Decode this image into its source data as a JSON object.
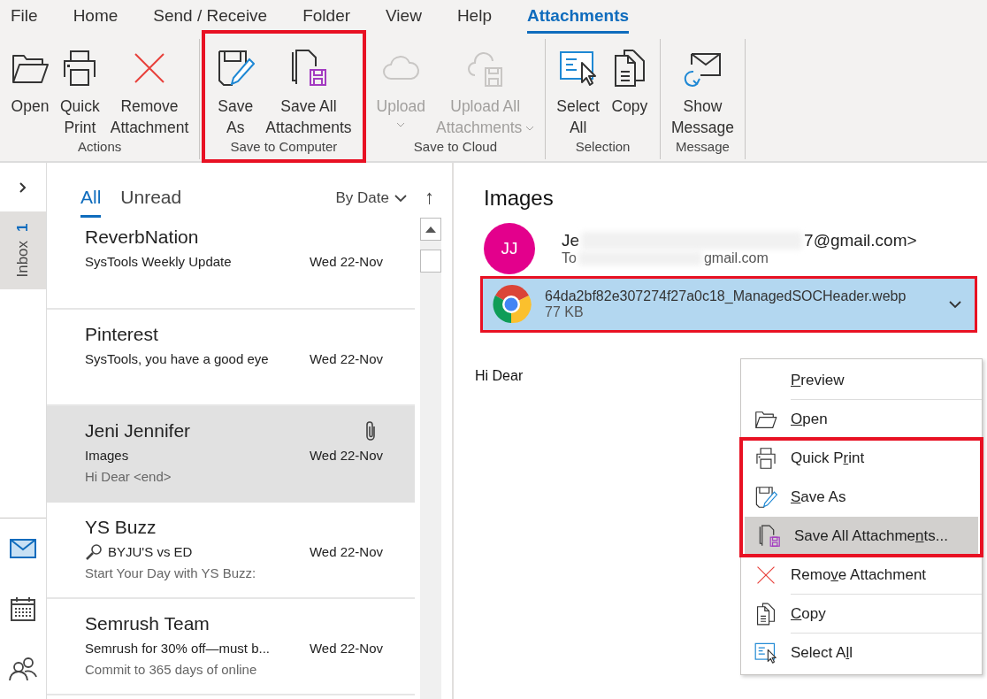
{
  "menu_tabs": [
    {
      "label": "File",
      "selected": false
    },
    {
      "label": "Home",
      "selected": false
    },
    {
      "label": "Send / Receive",
      "selected": false
    },
    {
      "label": "Folder",
      "selected": false
    },
    {
      "label": "View",
      "selected": false
    },
    {
      "label": "Help",
      "selected": false
    },
    {
      "label": "Attachments",
      "selected": true
    }
  ],
  "ribbon_groups": [
    {
      "label": "Actions",
      "highlighted": false,
      "buttons": [
        {
          "lines": [
            "Open"
          ],
          "disabled": false,
          "dropdown": false
        },
        {
          "lines": [
            "Quick",
            "Print"
          ],
          "disabled": false,
          "dropdown": false
        },
        {
          "lines": [
            "Remove",
            "Attachment"
          ],
          "disabled": false,
          "dropdown": false
        }
      ]
    },
    {
      "label": "Save to Computer",
      "highlighted": true,
      "buttons": [
        {
          "lines": [
            "Save",
            "As"
          ],
          "disabled": false,
          "dropdown": false
        },
        {
          "lines": [
            "Save All",
            "Attachments"
          ],
          "disabled": false,
          "dropdown": false
        }
      ]
    },
    {
      "label": "Save to Cloud",
      "highlighted": false,
      "buttons": [
        {
          "lines": [
            "Upload"
          ],
          "disabled": true,
          "dropdown": true
        },
        {
          "lines": [
            "Upload All",
            "Attachments"
          ],
          "disabled": true,
          "dropdown": true
        }
      ]
    },
    {
      "label": "Selection",
      "highlighted": false,
      "buttons": [
        {
          "lines": [
            "Select",
            "All"
          ],
          "disabled": false,
          "dropdown": false
        },
        {
          "lines": [
            "Copy"
          ],
          "disabled": false,
          "dropdown": false
        }
      ]
    },
    {
      "label": "Message",
      "highlighted": false,
      "buttons": [
        {
          "lines": [
            "Show",
            "Message"
          ],
          "disabled": false,
          "dropdown": false
        }
      ]
    }
  ],
  "nav_rail": {
    "folder": "Inbox",
    "count": "1",
    "apps": [
      {
        "selected": true
      },
      {
        "selected": false
      },
      {
        "selected": false
      }
    ]
  },
  "message_list": {
    "filters": [
      {
        "label": "All",
        "selected": true
      },
      {
        "label": "Unread",
        "selected": false
      }
    ],
    "sort": "By Date",
    "sort_direction": "↑",
    "messages": [
      {
        "sender": "ReverbNation",
        "subject": "SysTools Weekly Update",
        "date": "Wed 22-Nov",
        "selected": false,
        "attachment": false
      },
      {
        "sender": "Pinterest",
        "subject": "SysTools, you have a good eye",
        "date": "Wed 22-Nov",
        "selected": false,
        "attachment": false
      },
      {
        "sender": "Jeni Jennifer",
        "subject": "Images",
        "date": "Wed 22-Nov",
        "preview": "Hi Dear <end>",
        "selected": true,
        "attachment": true
      },
      {
        "sender": "YS Buzz",
        "subject": "BYJU'S vs ED",
        "date": "Wed 22-Nov",
        "preview": "Start Your Day with YS Buzz:",
        "selected": false,
        "attachment": false
      },
      {
        "sender": "Semrush Team",
        "subject": "Semrush for 30% off—must b...",
        "date": "Wed 22-Nov",
        "preview": "Commit to 365 days of online",
        "selected": false,
        "attachment": false
      }
    ]
  },
  "reading_pane": {
    "subject": "Images",
    "avatar_initials": "JJ",
    "from_start": "Je",
    "from_end": "7@gmail.com>",
    "to_label": "To",
    "to_end": "gmail.com",
    "attachment": {
      "name": "64da2bf82e307274f27a0c18_ManagedSOCHeader.webp",
      "size": "77 KB",
      "highlighted": true
    },
    "body": "Hi Dear"
  },
  "context_menu": {
    "sections": [
      {
        "highlighted": false,
        "items": [
          {
            "label_parts": [
              {
                "text": "P",
                "underline": true
              },
              {
                "text": "review",
                "underline": false
              }
            ],
            "selected": false
          },
          {
            "label_parts": [
              {
                "text": "O",
                "underline": true
              },
              {
                "text": "pen",
                "underline": false
              }
            ],
            "selected": false
          }
        ]
      },
      {
        "highlighted": true,
        "items": [
          {
            "label_parts": [
              {
                "text": "Quick P",
                "underline": false
              },
              {
                "text": "r",
                "underline": true
              },
              {
                "text": "int",
                "underline": false
              }
            ],
            "selected": false
          },
          {
            "label_parts": [
              {
                "text": "S",
                "underline": true
              },
              {
                "text": "ave As",
                "underline": false
              }
            ],
            "selected": false
          },
          {
            "label_parts": [
              {
                "text": "Save All Attachme",
                "underline": false
              },
              {
                "text": "n",
                "underline": true
              },
              {
                "text": "ts...",
                "underline": false
              }
            ],
            "selected": true
          }
        ]
      },
      {
        "highlighted": false,
        "items": [
          {
            "label_parts": [
              {
                "text": "Remo",
                "underline": false
              },
              {
                "text": "v",
                "underline": true
              },
              {
                "text": "e Attachment",
                "underline": false
              }
            ],
            "selected": false
          },
          {
            "label_parts": [
              {
                "text": "C",
                "underline": true
              },
              {
                "text": "opy",
                "underline": false
              }
            ],
            "selected": false
          },
          {
            "label_parts": [
              {
                "text": "Select A",
                "underline": false
              },
              {
                "text": "l",
                "underline": true
              },
              {
                "text": "l",
                "underline": false
              }
            ],
            "selected": false
          }
        ]
      }
    ]
  }
}
